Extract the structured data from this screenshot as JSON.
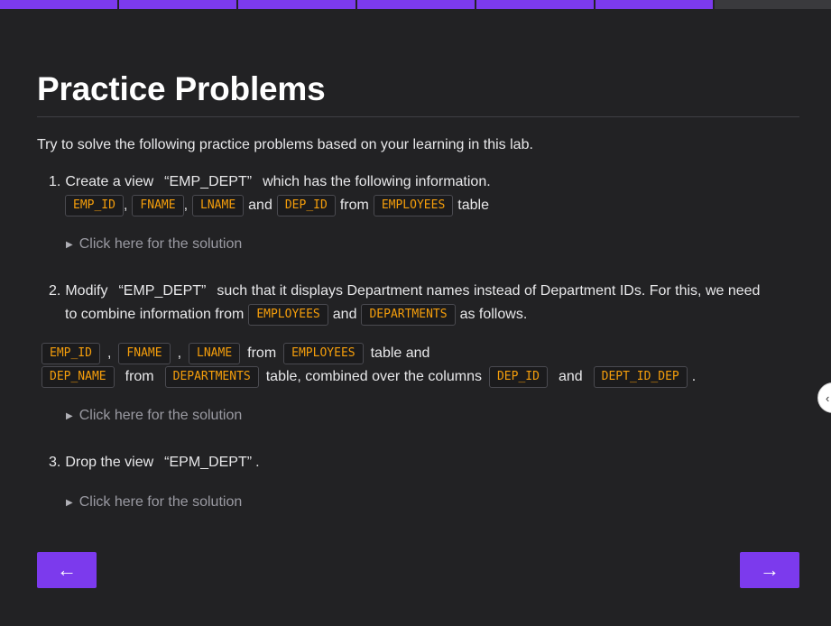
{
  "colors": {
    "accent": "#7c3aed",
    "background": "#222224",
    "code": "#f59e0b"
  },
  "progress": {
    "completed_segments": 6,
    "total_segments": 7
  },
  "page": {
    "title": "Practice Problems",
    "intro": "Try to solve the following practice problems based on your learning in this lab."
  },
  "problems": [
    {
      "number": "1.",
      "text_a": "Create a view",
      "quoted": "“EMP_DEPT”",
      "text_b": "which has the following information.",
      "codes": [
        "EMP_ID",
        "FNAME",
        "LNAME",
        "DEP_ID",
        "EMPLOYEES"
      ],
      "and": "and",
      "from": "from",
      "table": "table",
      "solution_label": "Click here for the solution"
    },
    {
      "number": "2.",
      "text_a": "Modify",
      "quoted": "“EMP_DEPT”",
      "text_b": "such that it displays Department names instead of Department IDs. For this, we need",
      "text_c": "to combine information from",
      "codes_a": [
        "EMPLOYEES",
        "DEPARTMENTS"
      ],
      "and": "and",
      "as_follows": "as follows.",
      "codes_b": [
        "EMP_ID",
        "FNAME",
        "LNAME",
        "EMPLOYEES"
      ],
      "from": "from",
      "table_and": "table and",
      "codes_c": [
        "DEP_NAME",
        "DEPARTMENTS",
        "DEP_ID",
        "DEPT_ID_DEP"
      ],
      "combined": "table, combined over the columns",
      "period": ".",
      "comma": ",",
      "solution_label": "Click here for the solution"
    },
    {
      "number": "3.",
      "text_a": "Drop the view",
      "quoted": "“EPM_DEPT”",
      "period": ".",
      "solution_label": "Click here for the solution"
    }
  ],
  "nav": {
    "prev_icon": "arrow-left-icon",
    "next_icon": "arrow-right-icon",
    "prev_glyph": "←",
    "next_glyph": "→"
  },
  "side_handle": {
    "icon": "chevron-left-icon",
    "glyph": "‹"
  }
}
